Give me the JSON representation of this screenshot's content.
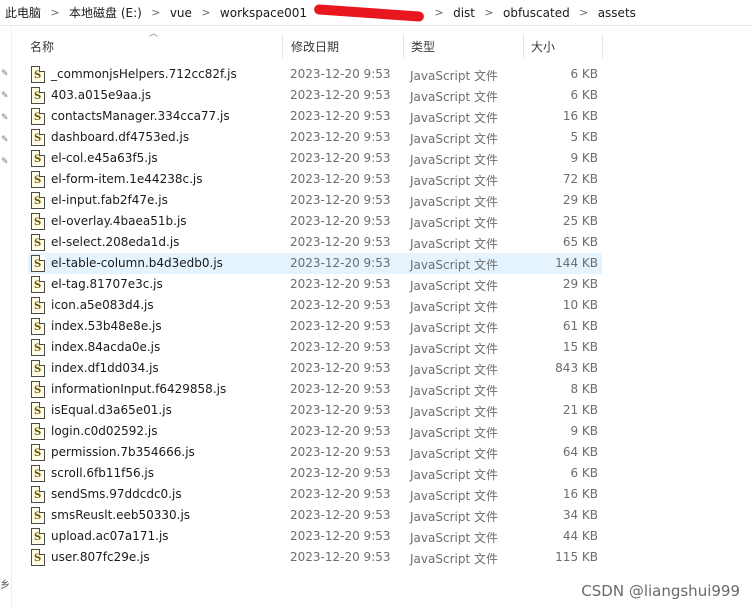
{
  "breadcrumb": {
    "items": [
      "此电脑",
      "本地磁盘 (E:)",
      "vue",
      "workspace001",
      "dist",
      "obfuscated",
      "assets"
    ],
    "separator": ">"
  },
  "columns": {
    "name": "名称",
    "date": "修改日期",
    "type": "类型",
    "size": "大小"
  },
  "nav_pane_text": "乡",
  "files": [
    {
      "name": "_commonjsHelpers.712cc82f.js",
      "date": "2023-12-20 9:53",
      "type": "JavaScript 文件",
      "size": "6 KB"
    },
    {
      "name": "403.a015e9aa.js",
      "date": "2023-12-20 9:53",
      "type": "JavaScript 文件",
      "size": "6 KB"
    },
    {
      "name": "contactsManager.334cca77.js",
      "date": "2023-12-20 9:53",
      "type": "JavaScript 文件",
      "size": "16 KB"
    },
    {
      "name": "dashboard.df4753ed.js",
      "date": "2023-12-20 9:53",
      "type": "JavaScript 文件",
      "size": "5 KB"
    },
    {
      "name": "el-col.e45a63f5.js",
      "date": "2023-12-20 9:53",
      "type": "JavaScript 文件",
      "size": "9 KB"
    },
    {
      "name": "el-form-item.1e44238c.js",
      "date": "2023-12-20 9:53",
      "type": "JavaScript 文件",
      "size": "72 KB"
    },
    {
      "name": "el-input.fab2f47e.js",
      "date": "2023-12-20 9:53",
      "type": "JavaScript 文件",
      "size": "29 KB"
    },
    {
      "name": "el-overlay.4baea51b.js",
      "date": "2023-12-20 9:53",
      "type": "JavaScript 文件",
      "size": "25 KB"
    },
    {
      "name": "el-select.208eda1d.js",
      "date": "2023-12-20 9:53",
      "type": "JavaScript 文件",
      "size": "65 KB"
    },
    {
      "name": "el-table-column.b4d3edb0.js",
      "date": "2023-12-20 9:53",
      "type": "JavaScript 文件",
      "size": "144 KB"
    },
    {
      "name": "el-tag.81707e3c.js",
      "date": "2023-12-20 9:53",
      "type": "JavaScript 文件",
      "size": "29 KB"
    },
    {
      "name": "icon.a5e083d4.js",
      "date": "2023-12-20 9:53",
      "type": "JavaScript 文件",
      "size": "10 KB"
    },
    {
      "name": "index.53b48e8e.js",
      "date": "2023-12-20 9:53",
      "type": "JavaScript 文件",
      "size": "61 KB"
    },
    {
      "name": "index.84acda0e.js",
      "date": "2023-12-20 9:53",
      "type": "JavaScript 文件",
      "size": "15 KB"
    },
    {
      "name": "index.df1dd034.js",
      "date": "2023-12-20 9:53",
      "type": "JavaScript 文件",
      "size": "843 KB"
    },
    {
      "name": "informationInput.f6429858.js",
      "date": "2023-12-20 9:53",
      "type": "JavaScript 文件",
      "size": "8 KB"
    },
    {
      "name": "isEqual.d3a65e01.js",
      "date": "2023-12-20 9:53",
      "type": "JavaScript 文件",
      "size": "21 KB"
    },
    {
      "name": "login.c0d02592.js",
      "date": "2023-12-20 9:53",
      "type": "JavaScript 文件",
      "size": "9 KB"
    },
    {
      "name": "permission.7b354666.js",
      "date": "2023-12-20 9:53",
      "type": "JavaScript 文件",
      "size": "64 KB"
    },
    {
      "name": "scroll.6fb11f56.js",
      "date": "2023-12-20 9:53",
      "type": "JavaScript 文件",
      "size": "6 KB"
    },
    {
      "name": "sendSms.97ddcdc0.js",
      "date": "2023-12-20 9:53",
      "type": "JavaScript 文件",
      "size": "16 KB"
    },
    {
      "name": "smsReuslt.eeb50330.js",
      "date": "2023-12-20 9:53",
      "type": "JavaScript 文件",
      "size": "34 KB"
    },
    {
      "name": "upload.ac07a171.js",
      "date": "2023-12-20 9:53",
      "type": "JavaScript 文件",
      "size": "44 KB"
    },
    {
      "name": "user.807fc29e.js",
      "date": "2023-12-20 9:53",
      "type": "JavaScript 文件",
      "size": "115 KB"
    }
  ],
  "hover_row": 9,
  "file_icon_glyph": "S",
  "watermark": "CSDN @liangshui999",
  "colors": {
    "hover": "#e5f3ff",
    "redaction": "#e8161d"
  }
}
